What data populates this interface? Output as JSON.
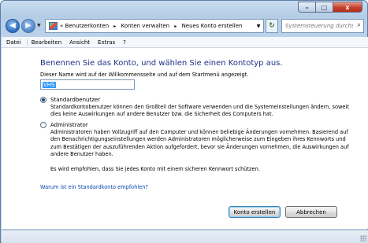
{
  "window": {
    "controls": {
      "minimize": "–",
      "maximize": "□",
      "close": "x"
    }
  },
  "nav": {
    "back_icon": "arrow-left-icon",
    "forward_icon": "arrow-right-icon",
    "address": {
      "prefix": "«",
      "crumbs": [
        "Benutzerkonten",
        "Konten verwalten",
        "Neues Konto erstellen"
      ],
      "separator": "▸"
    },
    "search_placeholder": "Systemsteuerung durchs..."
  },
  "menu": {
    "items": [
      "Datei",
      "Bearbeiten",
      "Ansicht",
      "Extras",
      "?"
    ]
  },
  "main": {
    "heading": "Benennen Sie das Konto, und wählen Sie einen Kontotyp aus.",
    "intro": "Dieser Name wird auf der Willkommensseite und auf dem Startmenü angezeigt.",
    "name_value": "VHS",
    "options": [
      {
        "label": "Standardbenutzer",
        "selected": true,
        "description": "Standardkontobenutzer können den Großteil der Software verwenden und die Systemeinstellungen ändern, soweit dies keine Auswirkungen auf andere Benutzer bzw. die Sicherheit des Computers hat."
      },
      {
        "label": "Administrator",
        "selected": false,
        "description": "Administratoren haben Vollzugriff auf den Computer und können beliebige Änderungen vornehmen. Basierend auf den Benachrichtigungseinstellungen werden Administratoren möglicherweise zum Eingeben ihres Kennworts und zum Bestätigen der auszuführenden Aktion aufgefordert, bevor sie Änderungen vornehmen, die Auswirkungen auf andere Benutzer haben."
      }
    ],
    "advice": "Es wird empfohlen, dass Sie jedes Konto mit einem sicheren Kennwort schützen.",
    "help_link": "Warum ist ein Standardkonto empfohlen?",
    "create_button": "Konto erstellen",
    "cancel_button": "Abbrechen"
  }
}
